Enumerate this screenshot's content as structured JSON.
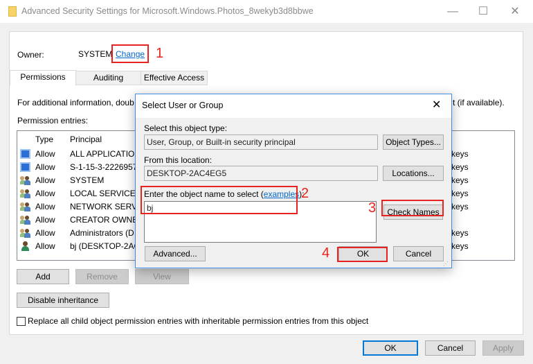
{
  "window": {
    "title": "Advanced Security Settings for Microsoft.Windows.Photos_8wekyb3d8bbwe",
    "minimize": "—",
    "maximize": "☐",
    "close": "✕"
  },
  "owner": {
    "label": "Owner:",
    "value": "SYSTEM",
    "change_link": "Change"
  },
  "tabs": [
    {
      "label": "Permissions",
      "selected": true
    },
    {
      "label": "Auditing"
    },
    {
      "label": "Effective Access"
    }
  ],
  "info_text_left": "For additional information, doub",
  "info_text_right": "t (if available).",
  "entries_label": "Permission entries:",
  "columns": {
    "type": "Type",
    "principal": "Principal"
  },
  "entries": [
    {
      "type": "Allow",
      "principal": "ALL APPLICATION",
      "access": "keys",
      "icon": "app-package-icon"
    },
    {
      "type": "Allow",
      "principal": "S-1-15-3-22269576",
      "access": "keys",
      "icon": "app-package-icon"
    },
    {
      "type": "Allow",
      "principal": "SYSTEM",
      "access": "keys",
      "icon": "group-icon"
    },
    {
      "type": "Allow",
      "principal": "LOCAL SERVICE",
      "access": "keys",
      "icon": "group-icon"
    },
    {
      "type": "Allow",
      "principal": "NETWORK SERVIC",
      "access": "keys",
      "icon": "group-icon"
    },
    {
      "type": "Allow",
      "principal": "CREATOR OWNER",
      "access": "",
      "icon": "group-icon"
    },
    {
      "type": "Allow",
      "principal": "Administrators (D",
      "access": "keys",
      "icon": "group-icon"
    },
    {
      "type": "Allow",
      "principal": "bj (DESKTOP-2AC",
      "access": "keys",
      "icon": "user-icon"
    }
  ],
  "buttons": {
    "add": "Add",
    "remove": "Remove",
    "view": "View",
    "disable_inheritance": "Disable inheritance",
    "ok": "OK",
    "cancel": "Cancel",
    "apply": "Apply"
  },
  "replace_checkbox": {
    "label": "Replace all child object permission entries with inheritable permission entries from this object",
    "checked": false
  },
  "dialog": {
    "title": "Select User or Group",
    "close": "✕",
    "object_type_label": "Select this object type:",
    "object_type_value": "User, Group, or Built-in security principal",
    "object_types_button": "Object Types...",
    "location_label": "From this location:",
    "location_value": "DESKTOP-2AC4EG5",
    "locations_button": "Locations...",
    "name_label": "Enter the object name to select (",
    "examples_link": "examples",
    "name_label_end": "):",
    "name_value": "bj",
    "check_names_button": "Check Names",
    "advanced_button": "Advanced...",
    "ok_button": "OK",
    "cancel_button": "Cancel"
  },
  "annotations": [
    "1",
    "2",
    "3",
    "4"
  ],
  "colors": {
    "annotation": "#e8231f",
    "link": "#0066cc",
    "focus": "#0078d7"
  }
}
